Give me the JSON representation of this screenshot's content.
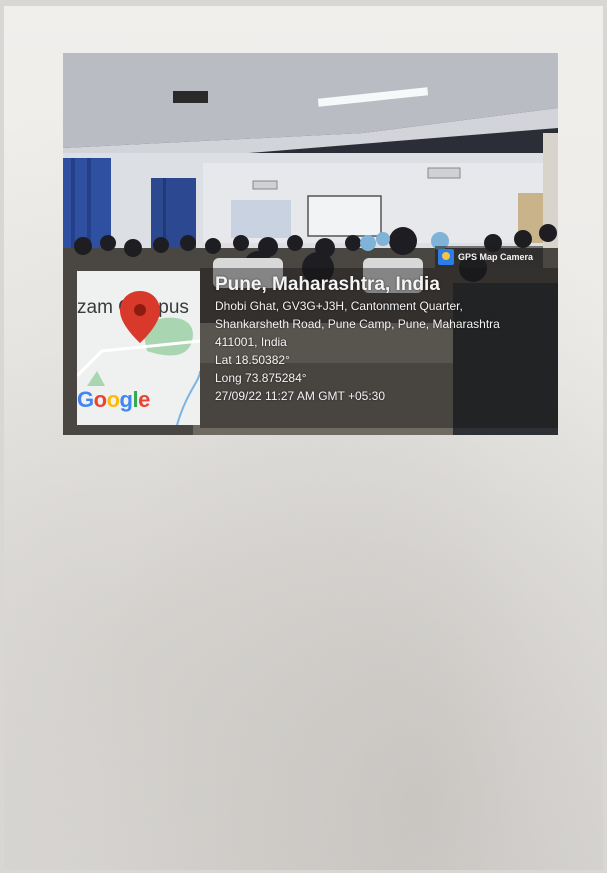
{
  "geotag": {
    "app_name": "GPS Map Camera",
    "location_title": "Pune, Maharashtra, India",
    "address_line1": "Dhobi Ghat, GV3G+J3H, Cantonment Quarter,",
    "address_line2": "Shankarsheth Road, Pune Camp, Pune, Maharashtra",
    "address_line3": "411001, India",
    "latitude": "Lat 18.50382°",
    "longitude": "Long 73.875284°",
    "datetime": "27/09/22 11:27 AM GMT +05:30"
  },
  "map": {
    "place_label": "zam Campus",
    "logo_text": "Google",
    "pin_color": "#d9392b"
  },
  "icons": [
    "map-pin-icon",
    "gps-map-camera-icon"
  ]
}
